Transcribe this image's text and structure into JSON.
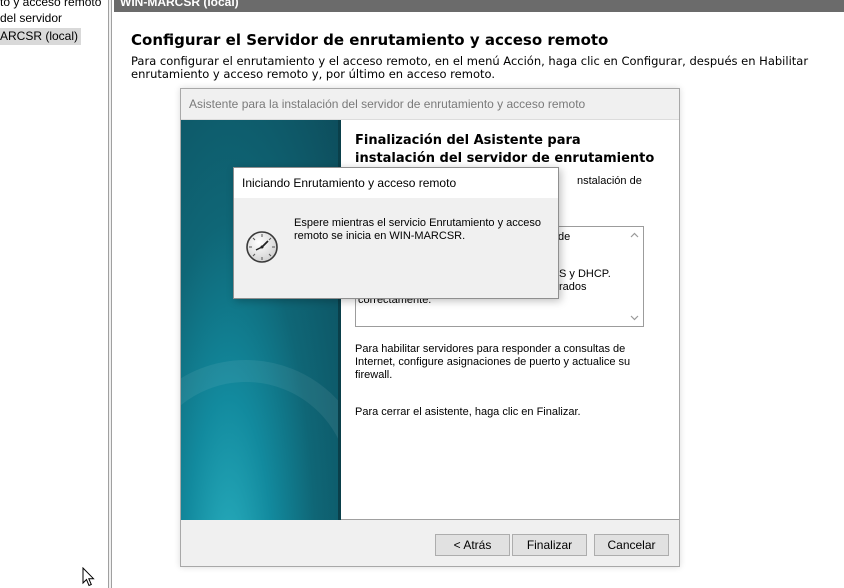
{
  "tree": {
    "items": [
      {
        "label": "to y acceso remoto"
      },
      {
        "label": "del servidor"
      },
      {
        "label": "ARCSR (local)"
      }
    ]
  },
  "pane": {
    "header": "WIN-MARCSR (local)",
    "title": "Configurar el Servidor de enrutamiento y acceso remoto",
    "description": "Para configurar el enrutamiento y el acceso remoto, en el menú Acción, haga clic en Configurar, después en Habilitar enrutamiento y acceso remoto y, por último en acceso remoto."
  },
  "wizard": {
    "title": "Asistente para la instalación del servidor de enrutamiento y acceso remoto",
    "heading": "Finalización del Asistente para instalación del servidor de enrutamiento y acceso remoto",
    "visible_fragment_1": "nstalación de",
    "summary_lines": [
      "de",
      "S y DHCP.",
      "rados",
      "correctamente."
    ],
    "paragraph_1": "Para habilitar servidores para responder a consultas de Internet, configure asignaciones de puerto y actualice su firewall.",
    "paragraph_2": "Para cerrar el asistente, haga clic en Finalizar.",
    "buttons": {
      "back": "< Atrás",
      "finish": "Finalizar",
      "cancel": "Cancelar"
    }
  },
  "dialog": {
    "title": "Iniciando Enrutamiento y acceso remoto",
    "message": "Espere mientras el servicio Enrutamiento y acceso remoto se inicia en WIN-MARCSR.",
    "icon": "clock-icon"
  },
  "colors": {
    "header_bar": "#6b6b6b",
    "wizard_art": "#0f6676",
    "selection": "#d9d9d9"
  }
}
